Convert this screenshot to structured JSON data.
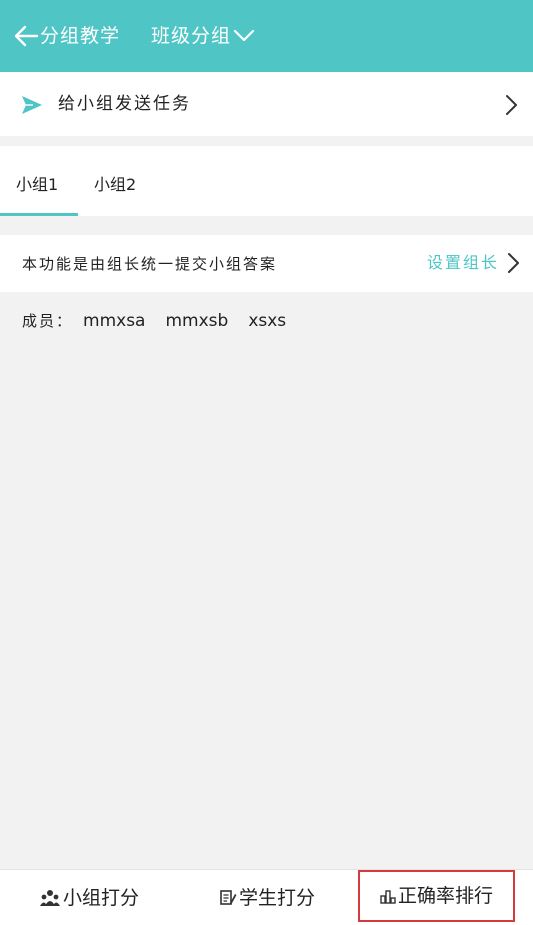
{
  "header": {
    "title": "分组教学",
    "class_selector": "班级分组",
    "bg_color": "#4fc5c6"
  },
  "send_task": {
    "label": "给小组发送任务",
    "icon": "send-icon"
  },
  "tabs": [
    {
      "label": "小组1",
      "active": true
    },
    {
      "label": "小组2",
      "active": false
    }
  ],
  "info": {
    "text": "本功能是由组长统一提交小组答案",
    "set_leader": "设置组长"
  },
  "members": {
    "label": "成员：",
    "names": [
      "mmxsa",
      "mmxsb",
      "xsxs"
    ]
  },
  "bottom_bar": {
    "items": [
      {
        "label": "小组打分",
        "icon": "group-icon"
      },
      {
        "label": "学生打分",
        "icon": "edit-icon"
      },
      {
        "label": "正确率排行",
        "icon": "ranking-icon",
        "highlighted": true
      }
    ]
  },
  "colors": {
    "accent": "#4fc5c6",
    "highlight_border": "#d63a3a"
  }
}
